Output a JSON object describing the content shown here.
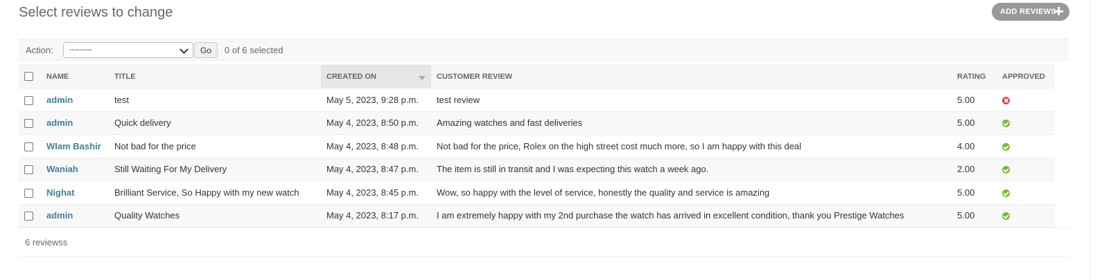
{
  "page": {
    "title": "Select reviews to change",
    "add_button_label": "ADD REVIEWS"
  },
  "actions": {
    "label": "Action:",
    "selected_option": "---------",
    "go_label": "Go",
    "selection_counter": "0 of 6 selected"
  },
  "table": {
    "headers": {
      "name": "NAME",
      "title": "TITLE",
      "created_on": "CREATED ON",
      "customer_review": "CUSTOMER REVIEW",
      "rating": "RATING",
      "approved": "APPROVED"
    },
    "sorted_column": "created_on",
    "rows": [
      {
        "name": "admin",
        "title": "test",
        "created_on": "May 5, 2023, 9:28 p.m.",
        "customer_review": "test review",
        "rating": "5.00",
        "approved": false
      },
      {
        "name": "admin",
        "title": "Quick delivery",
        "created_on": "May 4, 2023, 8:50 p.m.",
        "customer_review": "Amazing watches and fast deliveries",
        "rating": "5.00",
        "approved": true
      },
      {
        "name": "WIam Bashir",
        "title": "Not bad for the price",
        "created_on": "May 4, 2023, 8:48 p.m.",
        "customer_review": "Not bad for the price, Rolex on the high street cost much more, so I am happy with this deal",
        "rating": "4.00",
        "approved": true
      },
      {
        "name": "Waniah",
        "title": "Still Waiting For My Delivery",
        "created_on": "May 4, 2023, 8:47 p.m.",
        "customer_review": "The item is still in transit and I was expecting this watch a week ago.",
        "rating": "2.00",
        "approved": true
      },
      {
        "name": "Nighat",
        "title": "Brilliant Service, So Happy with my new watch",
        "created_on": "May 4, 2023, 8:45 p.m.",
        "customer_review": "Wow, so happy with the level of service, honestly the quality and service is amazing",
        "rating": "5.00",
        "approved": true
      },
      {
        "name": "admin",
        "title": "Quality Watches",
        "created_on": "May 4, 2023, 8:17 p.m.",
        "customer_review": "I am extremely happy with my 2nd purchase the watch has arrived in excellent condition, thank you Prestige Watches",
        "rating": "5.00",
        "approved": true
      }
    ]
  },
  "paginator": {
    "text": "6 reviewss"
  },
  "colors": {
    "link": "#447e9b",
    "approved_yes": "#70bf2b",
    "approved_no": "#dd4646",
    "add_button_bg": "#999999"
  },
  "icons": {
    "add": "plus-icon",
    "approved_yes": "check-circle-icon",
    "approved_no": "x-circle-icon",
    "select": "chevron-down-icon",
    "sort": "sort-desc-icon"
  }
}
